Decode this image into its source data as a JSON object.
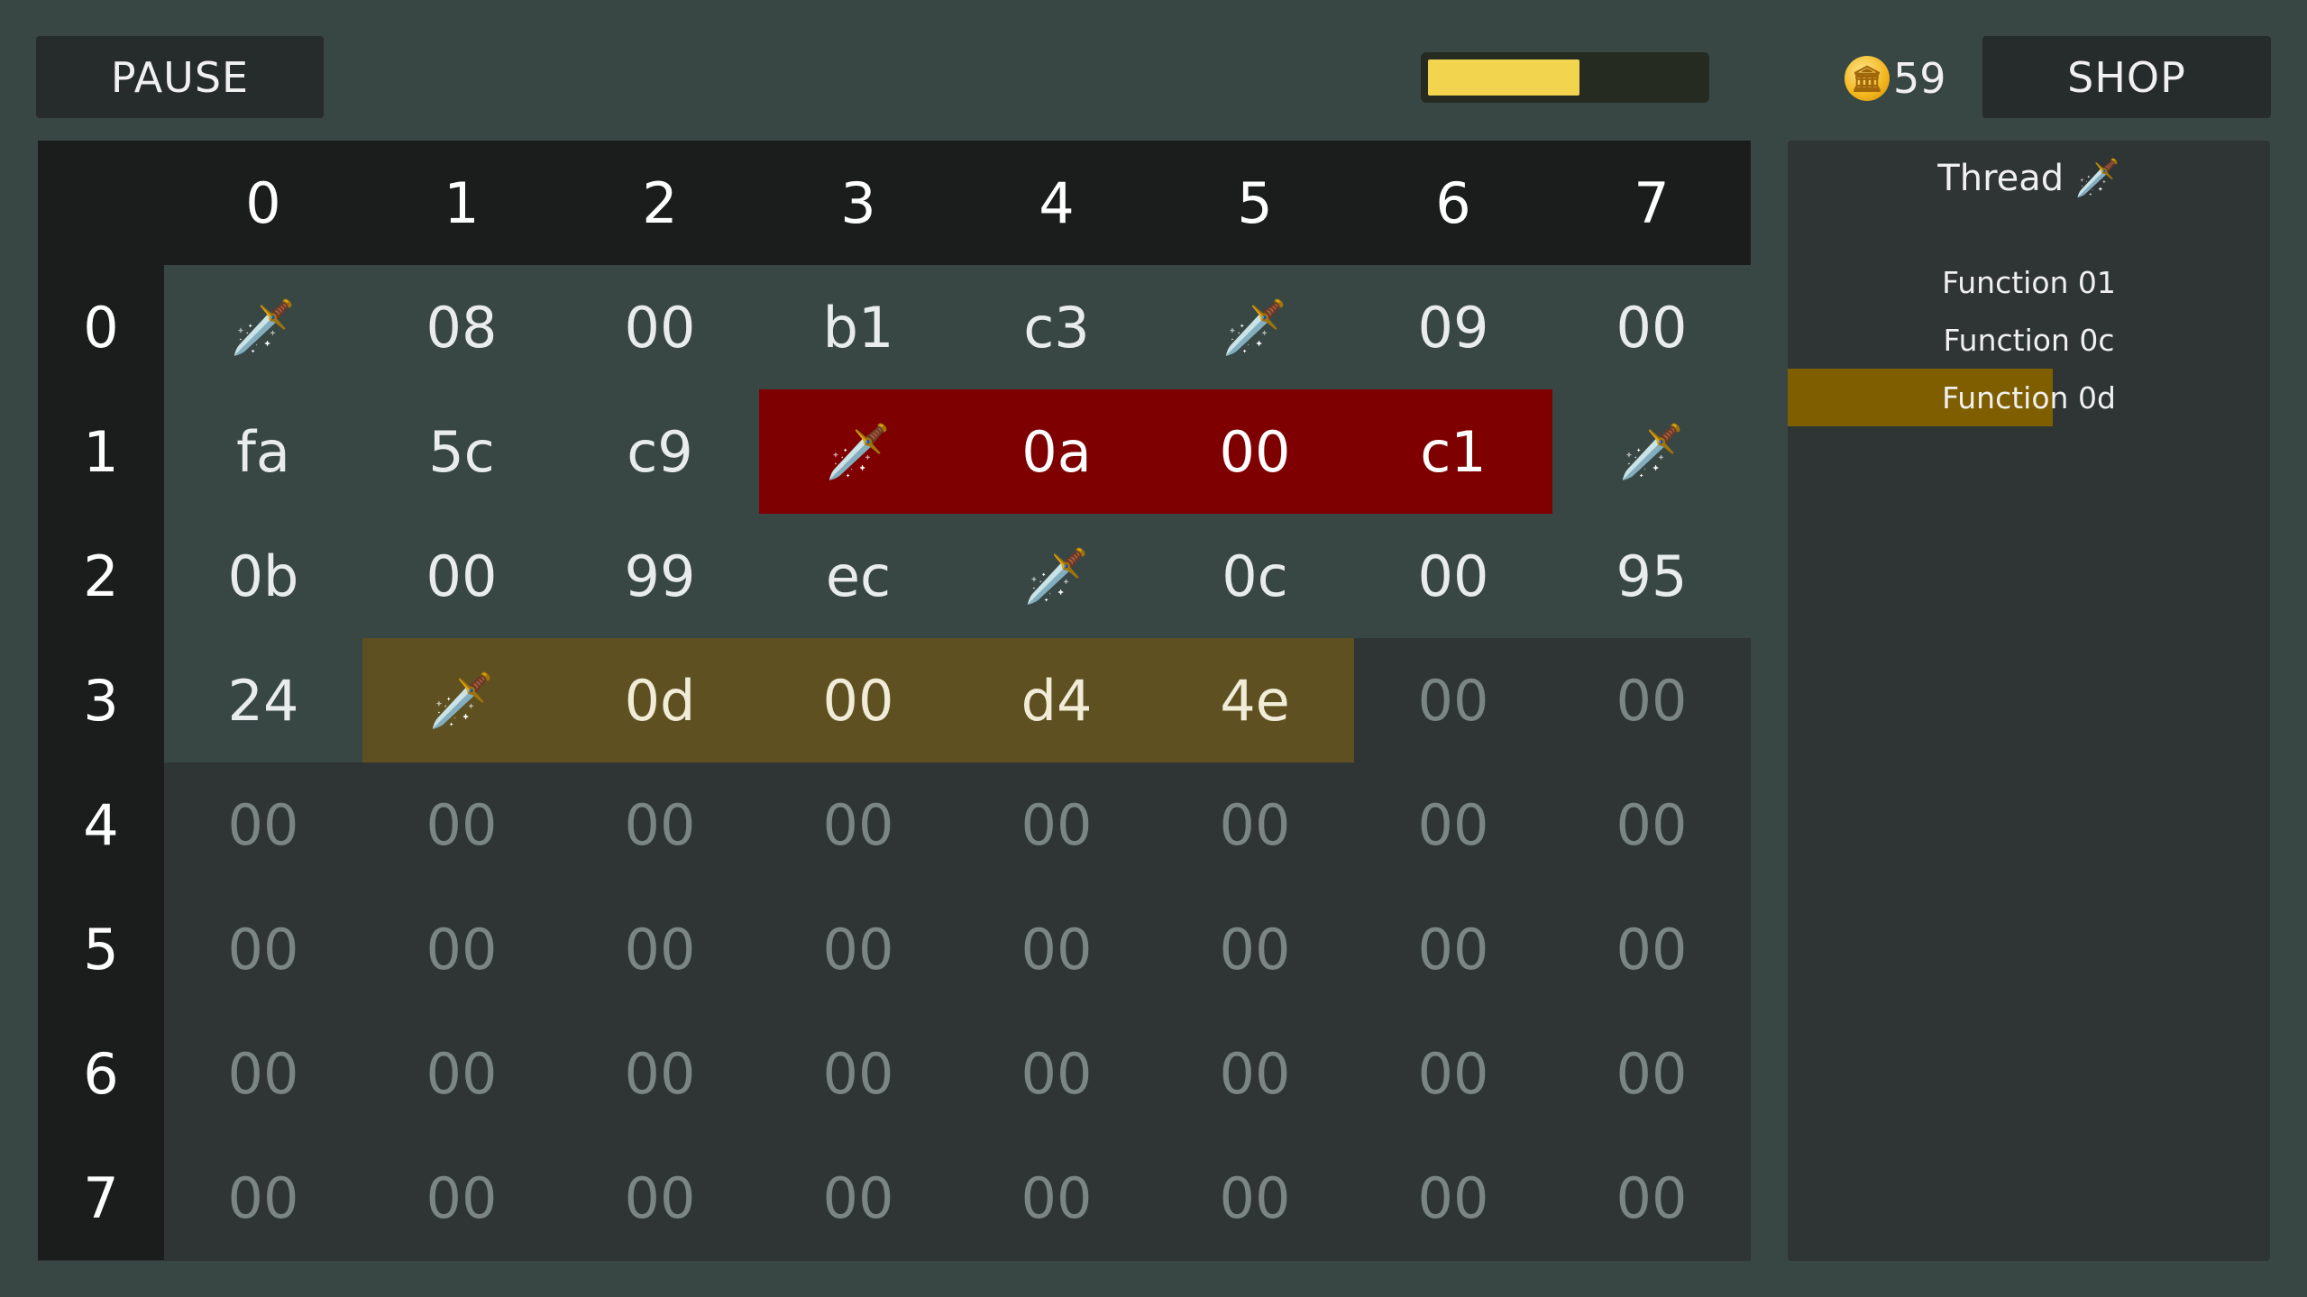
{
  "toolbar": {
    "pause_label": "PAUSE",
    "shop_label": "SHOP",
    "coins": "59",
    "coin_icon": "coin-icon",
    "progress": 0.55
  },
  "grid": {
    "col_headers": [
      "0",
      "1",
      "2",
      "3",
      "4",
      "5",
      "6",
      "7"
    ],
    "row_headers": [
      "0",
      "1",
      "2",
      "3",
      "4",
      "5",
      "6",
      "7"
    ],
    "rows": [
      [
        {
          "v": "🗡️",
          "s": "written"
        },
        {
          "v": "08",
          "s": "written"
        },
        {
          "v": "00",
          "s": "written"
        },
        {
          "v": "b1",
          "s": "written"
        },
        {
          "v": "c3",
          "s": "written"
        },
        {
          "v": "🗡️",
          "s": "written"
        },
        {
          "v": "09",
          "s": "written"
        },
        {
          "v": "00",
          "s": "written"
        }
      ],
      [
        {
          "v": "fa",
          "s": "written"
        },
        {
          "v": "5c",
          "s": "written"
        },
        {
          "v": "c9",
          "s": "written"
        },
        {
          "v": "🗡️",
          "s": "danger"
        },
        {
          "v": "0a",
          "s": "danger"
        },
        {
          "v": "00",
          "s": "danger"
        },
        {
          "v": "c1",
          "s": "danger"
        },
        {
          "v": "🗡️",
          "s": "written"
        }
      ],
      [
        {
          "v": "0b",
          "s": "written"
        },
        {
          "v": "00",
          "s": "written"
        },
        {
          "v": "99",
          "s": "written"
        },
        {
          "v": "ec",
          "s": "written"
        },
        {
          "v": "🗡️",
          "s": "written"
        },
        {
          "v": "0c",
          "s": "written"
        },
        {
          "v": "00",
          "s": "written"
        },
        {
          "v": "95",
          "s": "written"
        }
      ],
      [
        {
          "v": "24",
          "s": "written"
        },
        {
          "v": "🗡️",
          "s": "active"
        },
        {
          "v": "0d",
          "s": "active"
        },
        {
          "v": "00",
          "s": "active"
        },
        {
          "v": "d4",
          "s": "active"
        },
        {
          "v": "4e",
          "s": "active"
        },
        {
          "v": "00",
          "s": "empty"
        },
        {
          "v": "00",
          "s": "empty"
        }
      ],
      [
        {
          "v": "00",
          "s": "empty"
        },
        {
          "v": "00",
          "s": "empty"
        },
        {
          "v": "00",
          "s": "empty"
        },
        {
          "v": "00",
          "s": "empty"
        },
        {
          "v": "00",
          "s": "empty"
        },
        {
          "v": "00",
          "s": "empty"
        },
        {
          "v": "00",
          "s": "empty"
        },
        {
          "v": "00",
          "s": "empty"
        }
      ],
      [
        {
          "v": "00",
          "s": "empty"
        },
        {
          "v": "00",
          "s": "empty"
        },
        {
          "v": "00",
          "s": "empty"
        },
        {
          "v": "00",
          "s": "empty"
        },
        {
          "v": "00",
          "s": "empty"
        },
        {
          "v": "00",
          "s": "empty"
        },
        {
          "v": "00",
          "s": "empty"
        },
        {
          "v": "00",
          "s": "empty"
        }
      ],
      [
        {
          "v": "00",
          "s": "empty"
        },
        {
          "v": "00",
          "s": "empty"
        },
        {
          "v": "00",
          "s": "empty"
        },
        {
          "v": "00",
          "s": "empty"
        },
        {
          "v": "00",
          "s": "empty"
        },
        {
          "v": "00",
          "s": "empty"
        },
        {
          "v": "00",
          "s": "empty"
        },
        {
          "v": "00",
          "s": "empty"
        }
      ],
      [
        {
          "v": "00",
          "s": "empty"
        },
        {
          "v": "00",
          "s": "empty"
        },
        {
          "v": "00",
          "s": "empty"
        },
        {
          "v": "00",
          "s": "empty"
        },
        {
          "v": "00",
          "s": "empty"
        },
        {
          "v": "00",
          "s": "empty"
        },
        {
          "v": "00",
          "s": "empty"
        },
        {
          "v": "00",
          "s": "empty"
        }
      ]
    ]
  },
  "thread": {
    "title": "Thread",
    "title_icon": "sword-icon",
    "functions": [
      {
        "label": "Function 01",
        "progress": 0
      },
      {
        "label": "Function 0c",
        "progress": 0
      },
      {
        "label": "Function 0d",
        "progress": 0.55
      }
    ]
  },
  "colors": {
    "background": "#384644",
    "danger": "#7f0000",
    "active": "#5e5020",
    "progress": "#f2d44e",
    "function_highlight": "#7f5e00"
  }
}
